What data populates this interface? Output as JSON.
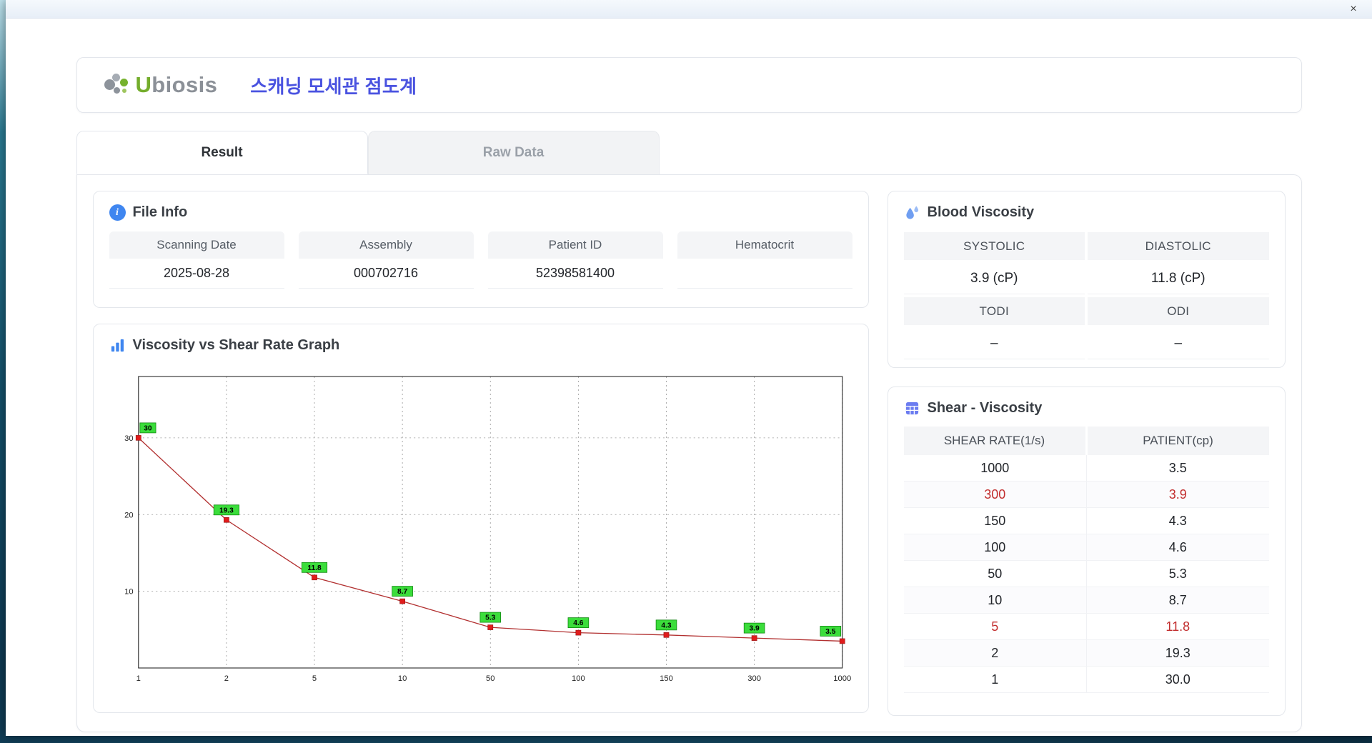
{
  "window": {
    "close": "×"
  },
  "header": {
    "logo_accent": "U",
    "logo_rest": "biosis",
    "title": "스캐닝 모세관 점도계"
  },
  "tabs": {
    "result": "Result",
    "raw_data": "Raw Data"
  },
  "file_info": {
    "title": "File Info",
    "fields": [
      {
        "label": "Scanning Date",
        "value": "2025-08-28"
      },
      {
        "label": "Assembly",
        "value": "000702716"
      },
      {
        "label": "Patient ID",
        "value": "52398581400"
      },
      {
        "label": "Hematocrit",
        "value": ""
      }
    ]
  },
  "graph": {
    "title": "Viscosity vs Shear Rate Graph"
  },
  "blood_viscosity": {
    "title": "Blood Viscosity",
    "cells": [
      {
        "label": "SYSTOLIC",
        "value": "3.9 (cP)"
      },
      {
        "label": "DIASTOLIC",
        "value": "11.8 (cP)"
      },
      {
        "label": "TODI",
        "value": "–"
      },
      {
        "label": "ODI",
        "value": "–"
      }
    ]
  },
  "shear_viscosity": {
    "title": "Shear - Viscosity",
    "columns": [
      "SHEAR RATE(1/s)",
      "PATIENT(cp)"
    ],
    "rows": [
      {
        "shear": "1000",
        "patient": "3.5",
        "highlight": false
      },
      {
        "shear": "300",
        "patient": "3.9",
        "highlight": true
      },
      {
        "shear": "150",
        "patient": "4.3",
        "highlight": false
      },
      {
        "shear": "100",
        "patient": "4.6",
        "highlight": false
      },
      {
        "shear": "50",
        "patient": "5.3",
        "highlight": false
      },
      {
        "shear": "10",
        "patient": "8.7",
        "highlight": false
      },
      {
        "shear": "5",
        "patient": "11.8",
        "highlight": true
      },
      {
        "shear": "2",
        "patient": "19.3",
        "highlight": false
      },
      {
        "shear": "1",
        "patient": "30.0",
        "highlight": false
      }
    ]
  },
  "chart_data": {
    "type": "line",
    "title": "Viscosity vs Shear Rate Graph",
    "xlabel": "",
    "ylabel": "",
    "x": [
      1,
      2,
      5,
      10,
      50,
      100,
      150,
      300,
      1000
    ],
    "values": [
      30,
      19.3,
      11.8,
      8.7,
      5.3,
      4.6,
      4.3,
      3.9,
      3.5
    ],
    "labels": [
      "30",
      "19.3",
      "11.8",
      "8.7",
      "5.3",
      "4.6",
      "4.3",
      "3.9",
      "3.5"
    ],
    "yticks": [
      10,
      20,
      30
    ],
    "ylim": [
      0,
      38
    ],
    "x_scale": "categorical-even-spacing",
    "grid": "dashed",
    "legend": "none",
    "line_color": "#b23030",
    "marker_color": "#e01c1c",
    "label_bg": "#3bdd3b"
  }
}
